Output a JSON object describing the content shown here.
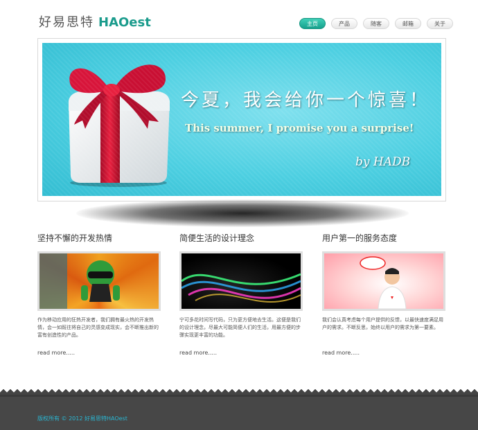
{
  "header": {
    "logo_cn": "好易思特",
    "logo_en": "HAOest",
    "nav": [
      {
        "label": "主页",
        "active": true
      },
      {
        "label": "产品",
        "active": false
      },
      {
        "label": "随客",
        "active": false
      },
      {
        "label": "邮箱",
        "active": false
      },
      {
        "label": "关于",
        "active": false
      }
    ]
  },
  "banner": {
    "headline": "今夏，我会给你一个惊喜！",
    "subline": "This summer, I promise you a surprise!",
    "byline": "by HADB",
    "colors": {
      "background": "#4ccfe1",
      "ribbon": "#d8143a"
    }
  },
  "columns": [
    {
      "title": "坚持不懈的开发热情",
      "text": "作为移动应用的狂热开发者，我们拥有最火热的开发热情，会一如既往将自己的灵感变成现实，会不断推出新的富有创造性的产品。",
      "more": "read more....."
    },
    {
      "title": "简便生活的设计理念",
      "text": "宁可多花时间写代码，只为更方便地去生活。这便是我们的设计理念，尽最大可能简便人们的生活，用最方便的步骤实现更丰富的功能。",
      "more": "read more....."
    },
    {
      "title": "用户第一的服务态度",
      "text": "我们会认真考虑每个用户提供的反馈，以最快速度满足用户的需求。不断反思，始终以用户的需求为第一要素。",
      "more": "read more....."
    }
  ],
  "footer": {
    "copyright": "版权所有 © 2012 好易思特HAOest"
  }
}
